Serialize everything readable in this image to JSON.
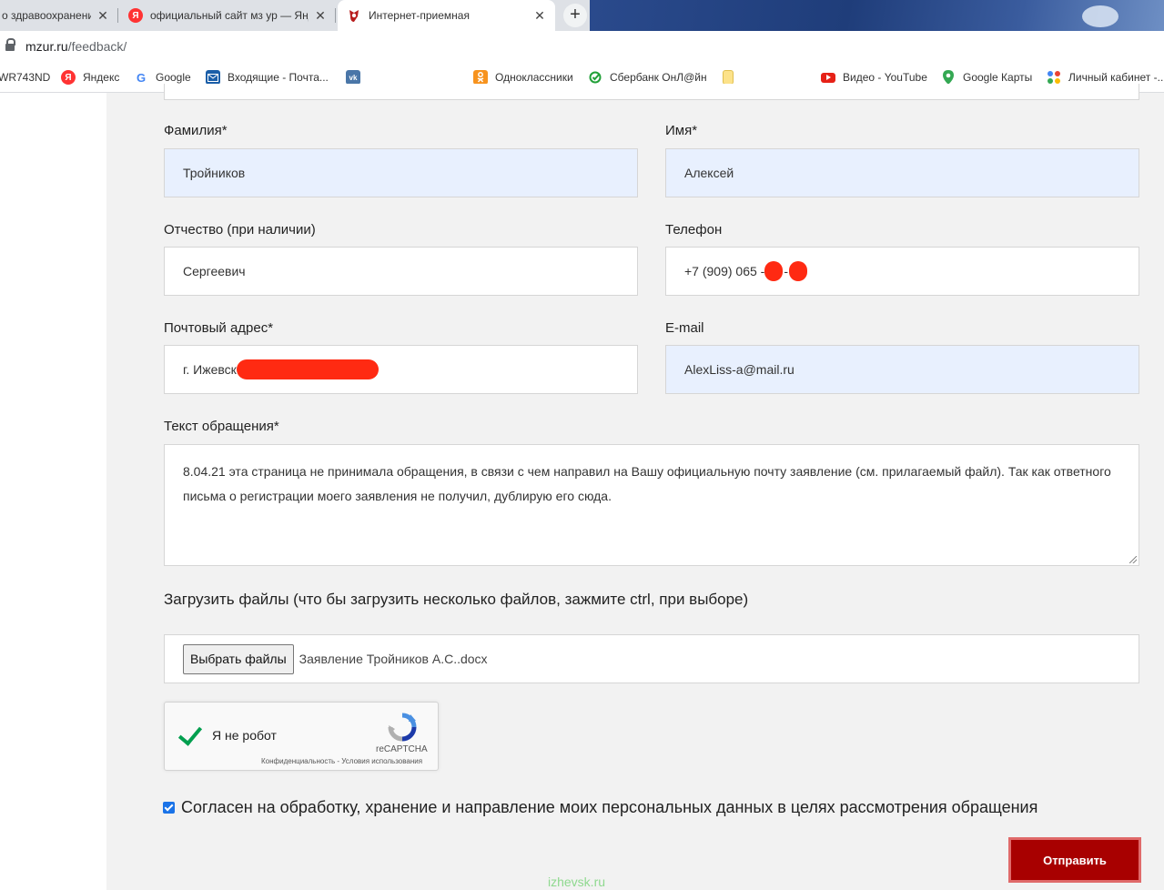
{
  "tabs": [
    {
      "title": "о здравоохранени",
      "close": "✕"
    },
    {
      "title": "официальный сайт мз ур — Янд",
      "close": "✕",
      "favicon_letter": "Я"
    },
    {
      "title": "Интернет-приемная",
      "close": "✕"
    }
  ],
  "new_tab": "+",
  "address": {
    "domain": "mzur.ru",
    "path": "/feedback/"
  },
  "bookmarks": [
    {
      "label": "WR743ND"
    },
    {
      "label": "Яндекс",
      "icon_letter": "Я"
    },
    {
      "label": "Google",
      "icon_letter": "G"
    },
    {
      "label": "Входящие - Почта..."
    },
    {
      "label": ""
    },
    {
      "label": "Одноклассники"
    },
    {
      "label": "Сбербанк ОнЛ@йн"
    },
    {
      "label": ""
    },
    {
      "label": "Видео - YouTube"
    },
    {
      "label": "Google Карты"
    },
    {
      "label": "Личный кабинет -..."
    }
  ],
  "form": {
    "last_name": {
      "label": "Фамилия*",
      "value": "Тройников"
    },
    "first_name": {
      "label": "Имя*",
      "value": "Алексей"
    },
    "patronymic": {
      "label": "Отчество (при наличии)",
      "value": "Сергеевич"
    },
    "phone": {
      "label": "Телефон",
      "value": "+7 (909) 065 -",
      "dash": "-"
    },
    "address": {
      "label": "Почтовый адрес*",
      "value": "г. Ижевск"
    },
    "email": {
      "label": "E-mail",
      "value": "AlexLiss-a@mail.ru"
    },
    "message": {
      "label": "Текст обращения*",
      "value": "8.04.21 эта страница не принимала обращения, в связи с чем направил на Вашу официальную почту заявление (см. прилагаемый файл). Так как ответного письма о регистрации моего заявления не получил, дублирую его сюда."
    },
    "upload": {
      "label": "Загрузить файлы (что бы загрузить несколько файлов, зажмите ctrl, при выборе)",
      "button": "Выбрать файлы",
      "file_name": "Заявление Тройников А.С..docx"
    },
    "captcha": {
      "text": "Я не робот",
      "brand": "reCAPTCHA",
      "privacy": "Конфиденциальность - Условия использования"
    },
    "consent": {
      "text": "Согласен на обработку, хранение и направление моих персональных данных в целях рассмотрения обращения",
      "checked": true
    },
    "submit": "Отправить"
  },
  "watermark": "izhevsk.ru",
  "colors": {
    "autofill": "#e8f0fe",
    "submit": "#a80000",
    "redaction": "#ff2a12",
    "page_bg": "#f2f2f2"
  }
}
